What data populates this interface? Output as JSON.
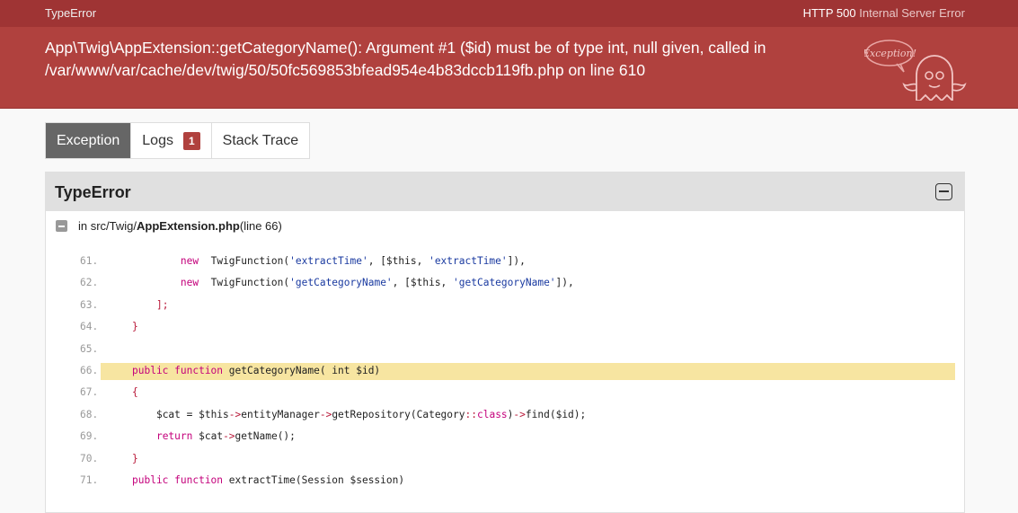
{
  "topbar": {
    "exception_type": "TypeError",
    "status_code": "HTTP 500",
    "status_text": "Internal Server Error"
  },
  "header": {
    "message_line1": "App\\Twig\\AppExtension::getCategoryName(): Argument #1 ($id) must be of type int, null given, called in",
    "message_line2": "/var/www/var/cache/dev/twig/50/50fc569853bfead954e4b83dccb119fb.php on line 610",
    "mascot_text": "Exception!"
  },
  "tabs": [
    {
      "label": "Exception",
      "active": true
    },
    {
      "label": "Logs",
      "badge": "1"
    },
    {
      "label": "Stack Trace"
    }
  ],
  "panel": {
    "title": "TypeError",
    "file_prefix": "in src/Twig/",
    "file_name": "AppExtension.php",
    "file_suffix": " (line 66)"
  },
  "code_lines": [
    {
      "num": "61.",
      "indent": "        ",
      "tokens": [
        [
          "kw",
          "new"
        ],
        [
          "",
          "  TwigFunction("
        ],
        [
          "str",
          "'extractTime'"
        ],
        [
          "",
          ", [$this, "
        ],
        [
          "str",
          "'extractTime'"
        ],
        [
          "",
          "]),"
        ]
      ]
    },
    {
      "num": "62.",
      "indent": "        ",
      "tokens": [
        [
          "kw",
          "new"
        ],
        [
          "",
          "  TwigFunction("
        ],
        [
          "str",
          "'getCategoryName'"
        ],
        [
          "",
          ", [$this, "
        ],
        [
          "str",
          "'getCategoryName'"
        ],
        [
          "",
          "]),"
        ]
      ]
    },
    {
      "num": "63.",
      "indent": "    ",
      "tokens": [
        [
          "op",
          "];"
        ]
      ]
    },
    {
      "num": "64.",
      "indent": "",
      "tokens": [
        [
          "op",
          "}"
        ]
      ]
    },
    {
      "num": "65.",
      "indent": "",
      "tokens": []
    },
    {
      "num": "66.",
      "indent": "",
      "hl": true,
      "tokens": [
        [
          "kw",
          "public function"
        ],
        [
          "",
          " getCategoryName( int $id)"
        ]
      ]
    },
    {
      "num": "67.",
      "indent": "",
      "tokens": [
        [
          "op",
          "{"
        ]
      ]
    },
    {
      "num": "68.",
      "indent": "    ",
      "tokens": [
        [
          "",
          "$cat = $this"
        ],
        [
          "op",
          "->"
        ],
        [
          "",
          "entityManager"
        ],
        [
          "op",
          "->"
        ],
        [
          "",
          "getRepository(Category"
        ],
        [
          "op",
          "::"
        ],
        [
          "kw",
          "class"
        ],
        [
          "",
          ")"
        ],
        [
          "op",
          "->"
        ],
        [
          "",
          "find($id);"
        ]
      ]
    },
    {
      "num": "69.",
      "indent": "    ",
      "tokens": [
        [
          "kw",
          "return"
        ],
        [
          "",
          " $cat"
        ],
        [
          "op",
          "->"
        ],
        [
          "",
          "getName();"
        ]
      ]
    },
    {
      "num": "70.",
      "indent": "",
      "tokens": [
        [
          "op",
          "}"
        ]
      ]
    },
    {
      "num": "71.",
      "indent": "",
      "tokens": [
        [
          "kw",
          "public function"
        ],
        [
          "",
          " extractTime(Session $session)"
        ]
      ]
    }
  ],
  "colors": {
    "topbar": "#9f3434",
    "header": "#b0413e",
    "highlight": "#f7e5a1",
    "keyword": "#c4007b",
    "string": "#1a3aa0"
  }
}
